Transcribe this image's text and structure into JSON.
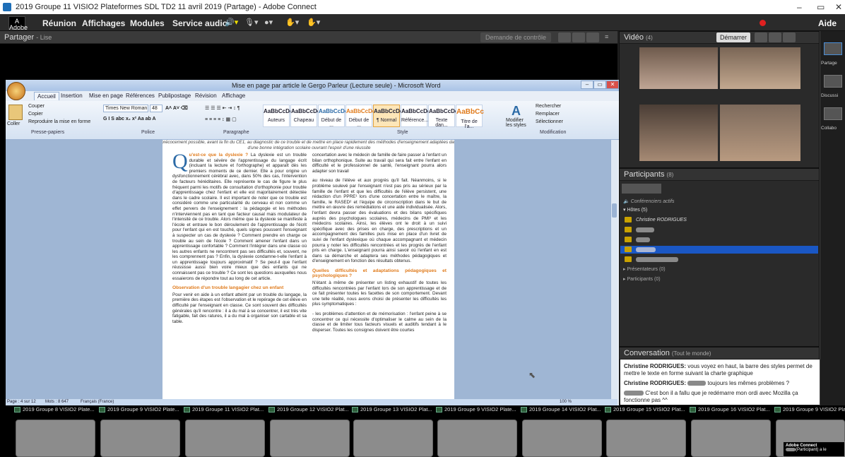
{
  "window": {
    "title": "2019 Groupe 11 VISIO2 Plateformes SDL TD2 11 avril 2019 (Partage) - Adobe Connect",
    "controls": [
      "–",
      "▭",
      "✕"
    ]
  },
  "menubar": {
    "logo_label": "Adobe",
    "items": [
      "Réunion",
      "Affichages",
      "Modules",
      "Service audio"
    ],
    "help": "Aide"
  },
  "share_pod": {
    "title": "Partager",
    "subtitle": "- Lise",
    "request_control": "Demande de contrôle"
  },
  "word": {
    "title": "Mise en page par article le Gergo Parleur (Lecture seule) - Microsoft Word",
    "tabs": [
      "Accueil",
      "Insertion",
      "Mise en page",
      "Références",
      "Publipostage",
      "Révision",
      "Affichage"
    ],
    "clipboard": {
      "paste": "Coller",
      "cut": "Couper",
      "copy": "Copier",
      "format": "Reproduire la mise en forme",
      "label": "Presse-papiers"
    },
    "font": {
      "name": "Times New Roman",
      "size": "48",
      "label": "Police"
    },
    "paragraph_label": "Paragraphe",
    "styles": [
      {
        "sample": "AaBbCcDdI",
        "name": "Auteurs"
      },
      {
        "sample": "AaBbCcDc",
        "name": "Chapeau"
      },
      {
        "sample": "AaBbCcDc",
        "name": "Début de ..."
      },
      {
        "sample": "AaBbCcDd",
        "name": "Début de ..."
      },
      {
        "sample": "AaBbCcDd",
        "name": "¶ Normal"
      },
      {
        "sample": "AaBbCcDd",
        "name": "Référence..."
      },
      {
        "sample": "AaBbCcDc",
        "name": "Texte dan..."
      },
      {
        "sample": "AaBbCc",
        "name": "Titre de l'a..."
      }
    ],
    "styles_label": "Style",
    "modify_styles": "Modifier les styles",
    "editing": {
      "find": "Rechercher",
      "replace": "Remplacer",
      "select": "Sélectionner",
      "label": "Modification"
    },
    "doc": {
      "intro": "le plus précocement possible, avant la fin du CE1, au diagnostic de ce trouble et de mettre en place rapidement des méthodes d'enseignement adaptées dans le but d'une bonne intégration scolaire ouvrant l'espoir d'une réussite",
      "col1_p1_lead": "u'est-ce que la dyslexie ?",
      "col1_p1": "La dyslexie est un trouble durable et sévère de l'apprentissage du langage écrit (incluant la lecture et l'orthographe) et apparaît dès les premiers moments de ce dernier. Elle a pour origine un dysfonctionnement cérébral avec, dans 50% des cas, l'intervention de facteurs héréditaires. Elle représente le cas de figure le plus fréquent parmi les motifs de consultation d'orthophonie pour trouble d'apprentissage chez l'enfant et elle est majoritairement détectée dans le cadre scolaire. Il est important de noter que ce trouble est considéré comme une particularité du cerveau et non comme un effet pervers de l'enseignement : la pédagogie et les méthodes n'interviennent pas en tant que facteur causal mais modulateur de l'intensité de ce trouble. Alors même que la dyslexie se manifeste à l'école et entrave le bon déroulement de l'apprentissage de l'écrit pour l'enfant qui en est touché, quels signes poussent l'enseignant à suspecter un cas de dyslexie ? Comment prendre en charge ce trouble au sein de l'école ? Comment amener l'enfant dans un apprentissage confortable ? Comment l'intégrer dans une classe où les autres enfants ne rencontrent pas ses difficultés et, souvent, ne les comprennent pas ? Enfin, la dyslexie condamne-t-elle l'enfant à un apprentissage toujours approximatif ? Se peut-il que l'enfant réussisse aussi bien voire mieux que des enfants qui ne connaissent pas ce trouble ? Ce sont les questions auxquelles nous essaierons de répondre tout au long de cet article.",
      "col1_h2": "Observation d'un trouble langagier chez un enfant",
      "col1_p2": "Pour venir en aide à un enfant atteint par un trouble du langage, la première des étapes est l'observation et le repérage de cet élève en difficulté par l'enseignant en classe. Ce sont souvent des difficultés générales qu'il rencontre : il a du mal à se concentrer, il est très vite fatigable, fait des ratures, il a du mal à organiser son cartable et sa table.",
      "col2_p1": "concertation avec le médecin de famille de faire passer à l'enfant un bilan orthophonique. Suite au travail qui sera fait entre l'enfant en difficulté et le professionnel de santé, l'enseignant pourra alors adapter son travail",
      "col2_p2": "au niveau de l'élève et aux progrès qu'il fait. Néanmoins, si le problème soulevé par l'enseignant n'est pas pris au sérieux par la famille de l'enfant et que les difficultés de l'élève persistent, une rédaction d'un PPRE¹ lors d'une concertation entre le maître, la famille, le RASED² et l'équipe de circonscription dans le but de mettre en œuvre des remédiations et une aide individualisée. Alors, l'enfant devra passer des évaluations et des bilans spécifiques auprès des psychologues scolaires, médecins de PMI³ et les médecins scolaires. Ainsi, les élèves ont le droit à un suivi spécifique avec des prises en charge, des prescriptions et un accompagnement des familles puis mise en place d'un livret de suivi de l'enfant dyslexique où chaque accompagnant et médecin pourra y noter les difficultés rencontrées et les progrès de l'enfant pris en charge. L'enseignant pourra ainsi savoir où l'enfant en est dans sa démarche et adaptera ses méthodes pédagogiques et d'enseignement en fonction des résultats obtenus.",
      "col2_h2": "Quelles difficultés et adaptations pédagogiques et psychologiques ?",
      "col2_p3": "N'étant à même de présenter un listing exhaustif de toutes les difficultés rencontrées par l'enfant lors de son apprentissage et de ce fait présenter toutes les facettes de son comportement. Devant une telle réalité, nous avons choisi de présenter les difficultés les plus symptomatiques :",
      "col2_p4": "- les problèmes d'attention et de mémorisation : l'enfant peine à se concentrer ce qui nécessite d'optimaliser le calme au sein de la classe et de limiter tous facteurs visuels et auditifs tendant à le disperser. Toutes les consignes doivent être courtes"
    },
    "status": {
      "page": "Page : 4 sur 12",
      "words": "Mots : 8 647",
      "lang": "Français (France)",
      "zoom": "100 %"
    }
  },
  "video_pod": {
    "title": "Vidéo",
    "count": "(4)",
    "start": "Démarrer"
  },
  "participants_pod": {
    "title": "Participants",
    "count": "(8)",
    "active_speakers": "Conférenciers actifs",
    "hosts": "Hôtes (5)",
    "host_name": "Christine RODRIGUES",
    "presenters": "Présentateurs (0)",
    "participants": "Participants (0)"
  },
  "chat_pod": {
    "title": "Conversation",
    "scope": "(Tout le monde)",
    "messages": [
      {
        "author": "Christine RODRIGUES:",
        "text": "vous voyez en haut, la barre des styles permet de mettre le texte en forme suivant la charte graphique"
      },
      {
        "author": "Christine RODRIGUES:",
        "text": "toujours les mêmes problèmes ?"
      },
      {
        "author": "",
        "text": "C'est bon il a fallu que je redémarre mon ordi avec Mozilla ça fonctionne pas ^^"
      }
    ]
  },
  "sidebar": {
    "items": [
      "Partage",
      "Discussi",
      "Collabo"
    ]
  },
  "taskbar": {
    "windows": [
      "2019 Groupe 8 VISIO2 Plate...",
      "2019 Groupe 9 VISIO2 Plate...",
      "2019 Groupe 11 VISIO2 Plat...",
      "2019 Groupe 12 VISIO2 Plat...",
      "2019 Groupe 13 VISIO2 Plat...",
      "2019 Groupe 9 VISIO2 Plate...",
      "2019 Groupe 14 VISIO2 Plat...",
      "2019 Groupe 15 VISIO2 Plat...",
      "2019 Groupe 16 VISIO2 Plat...",
      "2019 Groupe 9 VISIO2 Plate"
    ]
  },
  "toast": {
    "title": "Adobe Connect",
    "text": "(Participant) a le"
  },
  "colors": {
    "accent_orange": "#e07b1c",
    "selection_blue": "#1a57c4",
    "record_red": "#e02020"
  }
}
